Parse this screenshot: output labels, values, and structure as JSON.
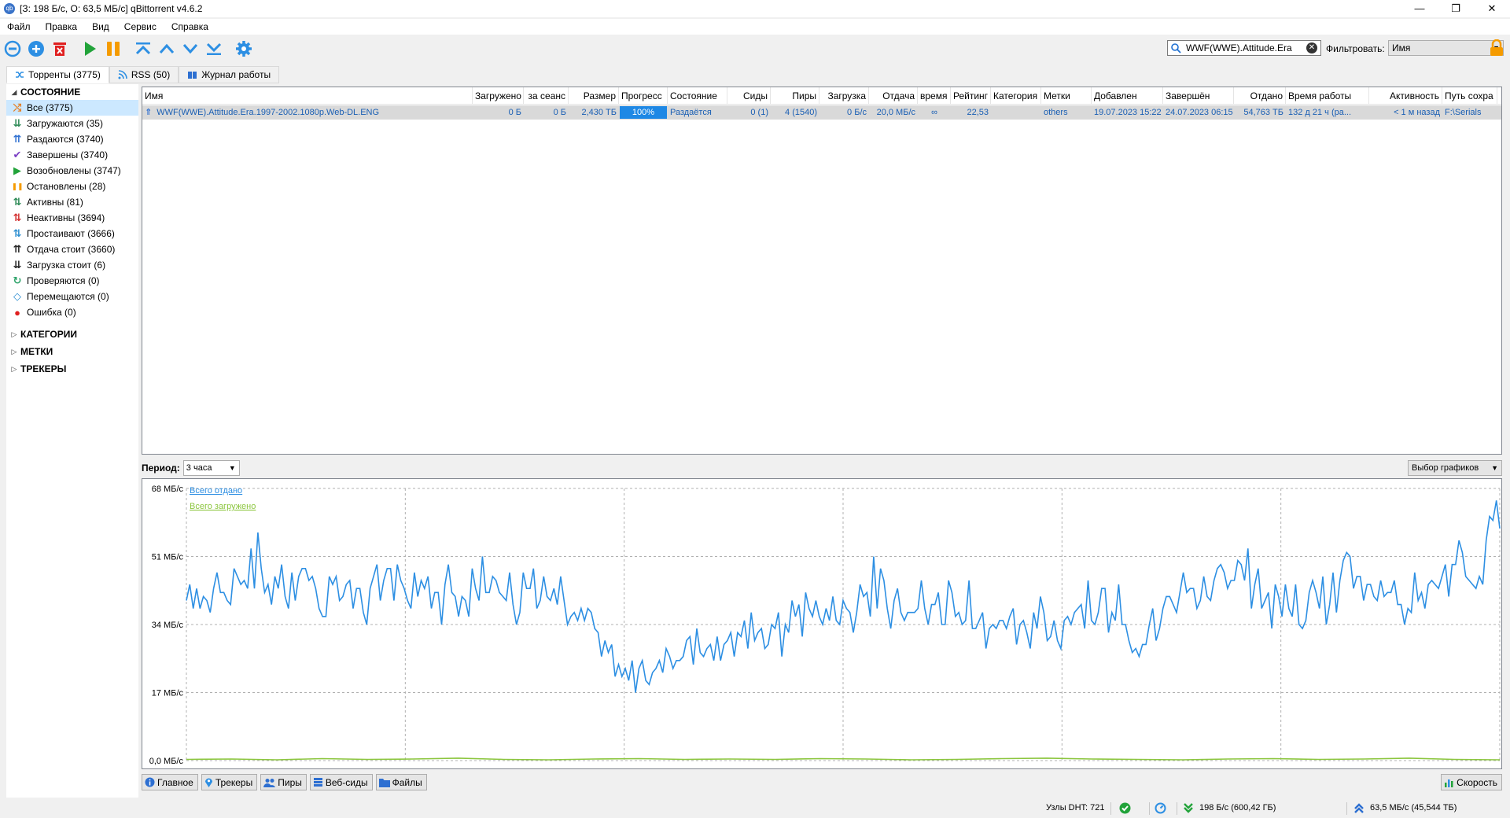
{
  "window": {
    "title": "[З: 198 Б/с, О: 63,5 МБ/с] qBittorrent v4.6.2",
    "minimize": "—",
    "maximize": "❐",
    "close": "✕"
  },
  "menu": [
    "Файл",
    "Правка",
    "Вид",
    "Сервис",
    "Справка"
  ],
  "toolbar": {
    "icons": [
      "add-link-icon",
      "add-torrent-icon",
      "delete-icon",
      "resume-icon",
      "pause-icon",
      "move-top-icon",
      "move-up-icon",
      "move-down-icon",
      "move-bottom-icon",
      "options-icon"
    ],
    "search_value": "WWF(WWE).Attitude.Era",
    "filter_label": "Фильтровать:",
    "filter_value": "Имя"
  },
  "tabs": {
    "torrents": "Торренты (3775)",
    "rss": "RSS (50)",
    "log": "Журнал работы"
  },
  "sidebar": {
    "status_header": "СОСТОЯНИЕ",
    "items": [
      {
        "label": "Все (3775)",
        "icon": "all-icon",
        "color": "#e67e22"
      },
      {
        "label": "Загружаются (35)",
        "icon": "downloading-icon",
        "color": "#2e8b57"
      },
      {
        "label": "Раздаются (3740)",
        "icon": "seeding-icon",
        "color": "#2d6fd1"
      },
      {
        "label": "Завершены (3740)",
        "icon": "completed-icon",
        "color": "#7b3fc4"
      },
      {
        "label": "Возобновлены (3747)",
        "icon": "resumed-icon",
        "color": "#22a33a"
      },
      {
        "label": "Остановлены (28)",
        "icon": "paused-icon",
        "color": "#f59b00"
      },
      {
        "label": "Активны (81)",
        "icon": "active-icon",
        "color": "#2e8b57"
      },
      {
        "label": "Неактивны (3694)",
        "icon": "inactive-icon",
        "color": "#d32f2f"
      },
      {
        "label": "Простаивают (3666)",
        "icon": "stalled-icon",
        "color": "#2d8fd1"
      },
      {
        "label": "Отдача стоит (3660)",
        "icon": "stalled-upload-icon",
        "color": "#222222"
      },
      {
        "label": "Загрузка стоит (6)",
        "icon": "stalled-download-icon",
        "color": "#222222"
      },
      {
        "label": "Проверяются (0)",
        "icon": "checking-icon",
        "color": "#2ea36a"
      },
      {
        "label": "Перемещаются (0)",
        "icon": "moving-icon",
        "color": "#2d8fd1"
      },
      {
        "label": "Ошибка (0)",
        "icon": "error-icon",
        "color": "#e02020"
      }
    ],
    "categories_header": "КАТЕГОРИИ",
    "tags_header": "МЕТКИ",
    "trackers_header": "ТРЕКЕРЫ"
  },
  "table": {
    "columns": [
      "Имя",
      "Загружено",
      "за сеанс",
      "Размер",
      "Прогресс",
      "Состояние",
      "Сиды",
      "Пиры",
      "Загрузка",
      "Отдача",
      "время",
      "Рейтинг",
      "Категория",
      "Метки",
      "Добавлен",
      "Завершён",
      "Отдано",
      "Время работы",
      "Активность",
      "Путь сохра"
    ],
    "rows": [
      {
        "name": "WWF(WWE).Attitude.Era.1997-2002.1080p.Web-DL.ENG",
        "downloaded": "0 Б",
        "session": "0 Б",
        "size": "2,430 ТБ",
        "progress": "100%",
        "state": "Раздаётся",
        "seeds": "0 (1)",
        "peers": "4 (1540)",
        "down_speed": "0 Б/с",
        "up_speed": "20,0 МБ/с",
        "eta": "∞",
        "ratio": "22,53",
        "category": "",
        "tags": "others",
        "added": "19.07.2023 15:22",
        "completed": "24.07.2023 06:15",
        "uploaded": "54,763 ТБ",
        "time_active": "132 д 21 ч (ра...",
        "last_activity": "< 1 м назад",
        "save_path": "F:\\Serials"
      }
    ]
  },
  "speed_panel": {
    "period_label": "Период:",
    "period_value": "3 часа",
    "graph_select": "Выбор графиков"
  },
  "chart_data": {
    "type": "line",
    "yticks": [
      "68 МБ/с",
      "51 МБ/с",
      "34 МБ/с",
      "17 МБ/с",
      "0,0 МБ/с"
    ],
    "ylim": [
      0,
      68
    ],
    "series": [
      {
        "name": "Всего отдано",
        "color": "#2d8fe3",
        "values": [
          40,
          44,
          38,
          43,
          38,
          41,
          40,
          37,
          43,
          47,
          42,
          42,
          40,
          39,
          48,
          46,
          44,
          45,
          43,
          53,
          43,
          57,
          48,
          42,
          44,
          39,
          46,
          43,
          49,
          41,
          38,
          47,
          40,
          46,
          48,
          48,
          45,
          46,
          43,
          38,
          36,
          36,
          46,
          44,
          46,
          40,
          41,
          44,
          45,
          38,
          43,
          43,
          37,
          34,
          43,
          46,
          49,
          40,
          45,
          48,
          48,
          40,
          49,
          45,
          43,
          40,
          38,
          47,
          41,
          45,
          43,
          46,
          38,
          42,
          42,
          34,
          44,
          49,
          42,
          41,
          36,
          41,
          40,
          36,
          48,
          43,
          40,
          51,
          42,
          42,
          46,
          45,
          42,
          41,
          40,
          47,
          39,
          34,
          37,
          47,
          43,
          43,
          48,
          38,
          40,
          46,
          41,
          40,
          43,
          39,
          46,
          40,
          34,
          36,
          37,
          35,
          38,
          35,
          38,
          37,
          33,
          32,
          26,
          30,
          27,
          29,
          21,
          24,
          21,
          23,
          20,
          25,
          17,
          23,
          25,
          20,
          19,
          22,
          23,
          25,
          22,
          28,
          26,
          23,
          25,
          25,
          26,
          30,
          31,
          24,
          33,
          27,
          26,
          28,
          29,
          25,
          31,
          25,
          29,
          30,
          32,
          26,
          32,
          31,
          35,
          28,
          37,
          30,
          32,
          33,
          28,
          29,
          34,
          33,
          37,
          26,
          34,
          32,
          40,
          36,
          39,
          31,
          42,
          38,
          36,
          40,
          36,
          34,
          38,
          35,
          41,
          35,
          34,
          40,
          38,
          37,
          32,
          37,
          44,
          41,
          42,
          36,
          51,
          38,
          48,
          45,
          38,
          33,
          40,
          43,
          37,
          35,
          37,
          37,
          37,
          38,
          45,
          38,
          34,
          39,
          39,
          42,
          34,
          34,
          45,
          42,
          36,
          37,
          34,
          35,
          45,
          33,
          33,
          35,
          37,
          28,
          33,
          34,
          33,
          35,
          35,
          33,
          36,
          38,
          29,
          34,
          35,
          32,
          28,
          37,
          33,
          41,
          37,
          30,
          31,
          35,
          30,
          28,
          35,
          36,
          34,
          37,
          38,
          39,
          33,
          45,
          35,
          34,
          37,
          43,
          43,
          32,
          37,
          35,
          44,
          34,
          34,
          30,
          27,
          28,
          26,
          29,
          29,
          34,
          38,
          30,
          33,
          38,
          41,
          41,
          39,
          37,
          42,
          47,
          42,
          43,
          43,
          38,
          40,
          46,
          41,
          40,
          45,
          48,
          49,
          47,
          43,
          45,
          45,
          50,
          49,
          45,
          53,
          38,
          44,
          48,
          38,
          40,
          42,
          33,
          44,
          41,
          36,
          44,
          38,
          36,
          44,
          34,
          33,
          35,
          42,
          45,
          42,
          38,
          46,
          34,
          39,
          47,
          37,
          45,
          50,
          52,
          51,
          43,
          46,
          46,
          40,
          44,
          44,
          41,
          40,
          45,
          41,
          42,
          42,
          45,
          39,
          39,
          34,
          38,
          37,
          47,
          40,
          42,
          38,
          44,
          45,
          44,
          43,
          46,
          49,
          41,
          49,
          49,
          55,
          52,
          46,
          45,
          44,
          43,
          46,
          44,
          55,
          61,
          60,
          65,
          58
        ]
      },
      {
        "name": "Всего загружено",
        "color": "#8cc63f",
        "values": [
          0.3,
          0.4,
          0.2,
          0.5,
          0.3,
          0.4,
          0.6,
          0.3,
          0.2,
          0.4,
          0.5,
          0.3,
          0.4,
          0.3,
          0.5,
          0.4,
          0.2,
          0.3,
          0.5,
          0.6,
          0.4,
          0.3,
          0.2,
          0.4,
          0.5,
          0.3,
          0.4,
          0.6,
          0.3,
          0.2
        ]
      }
    ]
  },
  "bottom_tabs": {
    "general": "Главное",
    "trackers": "Трекеры",
    "peers": "Пиры",
    "webseeds": "Веб-сиды",
    "files": "Файлы",
    "speed": "Скорость"
  },
  "status": {
    "dht": "Узлы DHT: 721",
    "download": "198 Б/с (600,42 ГБ)",
    "upload": "63,5 МБ/с (45,544 ТБ)"
  }
}
